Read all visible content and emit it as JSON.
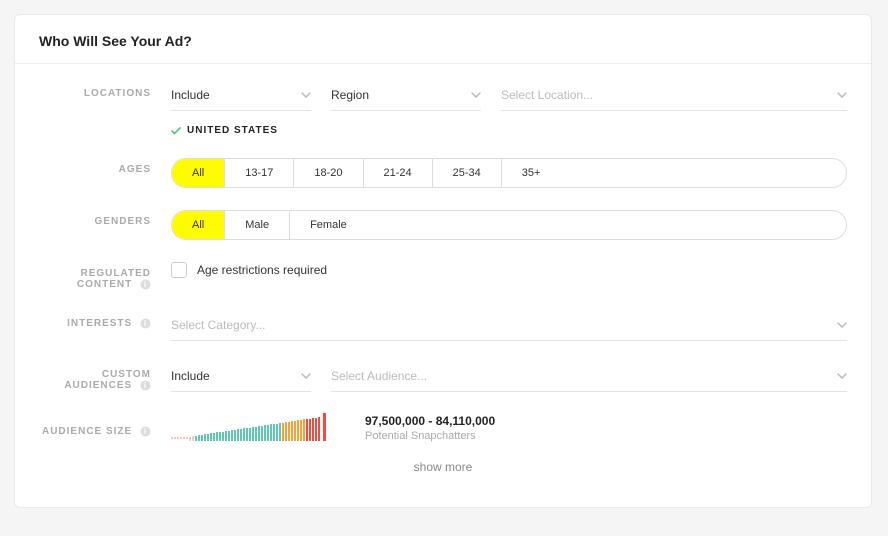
{
  "header": {
    "title": "Who Will See Your Ad?"
  },
  "labels": {
    "locations": "LOCATIONS",
    "ages": "AGES",
    "genders": "GENDERS",
    "regulated": "REGULATED CONTENT",
    "interests": "INTERESTS",
    "custom": "CUSTOM AUDIENCES",
    "audienceSize": "AUDIENCE SIZE"
  },
  "locations": {
    "mode": "Include",
    "scope": "Region",
    "placeholder": "Select Location...",
    "selected": [
      "UNITED STATES"
    ]
  },
  "ages": {
    "options": [
      "All",
      "13-17",
      "18-20",
      "21-24",
      "25-34",
      "35+"
    ],
    "selected": "All"
  },
  "genders": {
    "options": [
      "All",
      "Male",
      "Female"
    ],
    "selected": "All"
  },
  "regulated": {
    "checkboxLabel": "Age restrictions required",
    "checked": false
  },
  "interests": {
    "placeholder": "Select Category..."
  },
  "customAudiences": {
    "mode": "Include",
    "placeholder": "Select Audience..."
  },
  "audienceSize": {
    "range": "97,500,000 - 84,110,000",
    "sub": "Potential Snapchatters"
  },
  "showMore": "show more"
}
